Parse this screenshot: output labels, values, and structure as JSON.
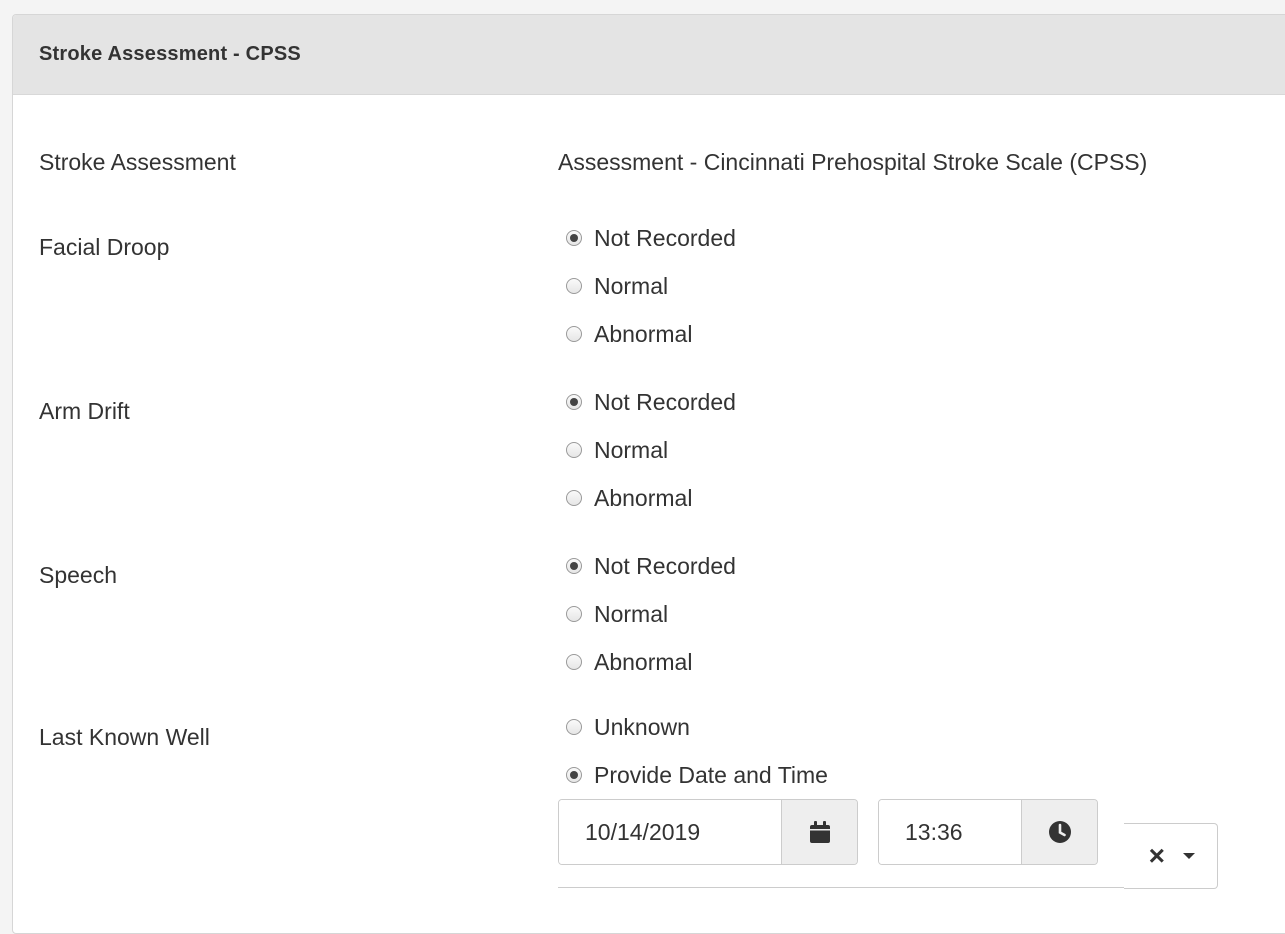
{
  "panel": {
    "title": "Stroke Assessment - CPSS"
  },
  "stroke_assessment": {
    "label": "Stroke Assessment",
    "value": "Assessment - Cincinnati Prehospital Stroke Scale (CPSS)"
  },
  "facial_droop": {
    "label": "Facial Droop",
    "options": [
      "Not Recorded",
      "Normal",
      "Abnormal"
    ],
    "selected": "Not Recorded"
  },
  "arm_drift": {
    "label": "Arm Drift",
    "options": [
      "Not Recorded",
      "Normal",
      "Abnormal"
    ],
    "selected": "Not Recorded"
  },
  "speech": {
    "label": "Speech",
    "options": [
      "Not Recorded",
      "Normal",
      "Abnormal"
    ],
    "selected": "Not Recorded"
  },
  "last_known_well": {
    "label": "Last Known Well",
    "options": [
      "Unknown",
      "Provide Date and Time"
    ],
    "selected": "Provide Date and Time",
    "date_value": "10/14/2019",
    "time_value": "13:36",
    "clear_symbol": "×"
  },
  "icons": {
    "date": "calendar-icon",
    "time": "clock-icon",
    "clear": "close-icon",
    "dropdown": "caret-down-icon"
  },
  "colors": {
    "header_bg": "#e4e4e4",
    "addon_bg": "#eeeeee",
    "border": "#cccccc",
    "text": "#333333"
  }
}
